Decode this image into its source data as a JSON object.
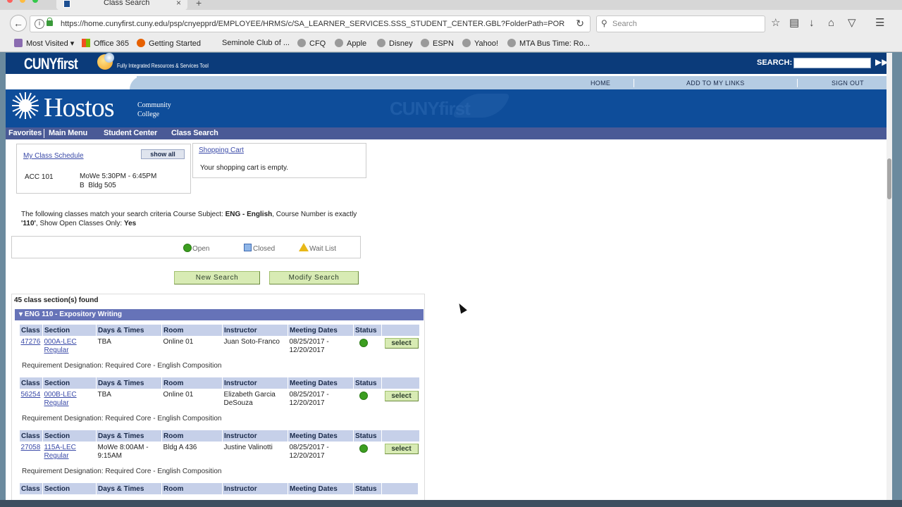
{
  "browser": {
    "tab_title": "Class Search",
    "tab_close": "×",
    "new_tab": "+",
    "url": "https://home.cunyfirst.cuny.edu/psp/cnyepprd/EMPLOYEE/HRMS/c/SA_LEARNER_SERVICES.SSS_STUDENT_CENTER.GBL?FolderPath=POR",
    "search_placeholder": "Search",
    "bookmarks": [
      "Most Visited",
      "Office 365",
      "Getting Started",
      "Seminole Club of ...",
      "CFQ",
      "Apple",
      "Disney",
      "ESPN",
      "Yahoo!",
      "MTA Bus Time: Ro..."
    ]
  },
  "cunyfirst": {
    "logo": "CUNYfirst",
    "tagline": "Fully Integrated Resources & Services Tool",
    "search_label": "SEARCH:",
    "nav": [
      "HOME",
      "ADD TO MY LINKS",
      "SIGN OUT"
    ],
    "watermark": "CUNYfirst"
  },
  "college": {
    "name": "Hostos",
    "sub_line1": "Community",
    "sub_line2": "College"
  },
  "breadcrumbs": [
    "Favorites",
    "Main Menu",
    "Student Center",
    "Class Search"
  ],
  "schedule": {
    "title": "My Class Schedule",
    "show_all": "show all",
    "course": "ACC 101",
    "time": "MoWe 5:30PM - 6:45PM",
    "location": "B  Bldg 505"
  },
  "cart": {
    "title": "Shopping Cart",
    "message": "Your shopping cart is empty."
  },
  "criteria": {
    "intro": "The following classes match your search criteria Course Subject: ",
    "subject": "ENG - English",
    "mid": ",  Course Number is exactly",
    "number": "'110'",
    "tail": ",  Show Open Classes Only: ",
    "open_only": "Yes"
  },
  "legend": {
    "open": "Open",
    "closed": "Closed",
    "wait": "Wait List"
  },
  "buttons": {
    "new_search": "New Search",
    "modify_search": "Modify Search"
  },
  "results": {
    "count": "45 class section(s) found",
    "course_title": "ENG 110 - Expository Writing",
    "headers": [
      "Class",
      "Section",
      "Days & Times",
      "Room",
      "Instructor",
      "Meeting Dates",
      "Status"
    ],
    "select_label": "select",
    "sections": [
      {
        "class_nbr": "47276",
        "section": "000A-LEC",
        "section_type": "Regular",
        "days_line1": "TBA",
        "days_line2": "",
        "room": "Online 01",
        "instructor_line1": "Juan Soto-Franco",
        "instructor_line2": "",
        "dates_line1": "08/25/2017 -",
        "dates_line2": "12/20/2017",
        "requirement": "Requirement Designation: Required Core - English Composition"
      },
      {
        "class_nbr": "56254",
        "section": "000B-LEC",
        "section_type": "Regular",
        "days_line1": "TBA",
        "days_line2": "",
        "room": "Online 01",
        "instructor_line1": "Elizabeth Garcia",
        "instructor_line2": "DeSouza",
        "dates_line1": "08/25/2017 -",
        "dates_line2": "12/20/2017",
        "requirement": "Requirement Designation: Required Core - English Composition"
      },
      {
        "class_nbr": "27058",
        "section": "115A-LEC",
        "section_type": "Regular",
        "days_line1": "MoWe 8:00AM -",
        "days_line2": "9:15AM",
        "room": "Bldg A 436",
        "instructor_line1": "Justine Valinotti",
        "instructor_line2": "",
        "dates_line1": "08/25/2017 -",
        "dates_line2": "12/20/2017",
        "requirement": "Requirement Designation: Required Core - English Composition"
      }
    ]
  }
}
